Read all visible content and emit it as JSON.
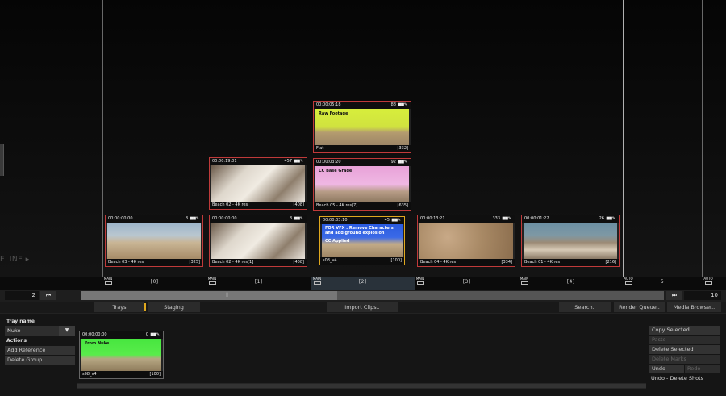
{
  "timeline": {
    "label": "ELINE ▸",
    "clips": [
      {
        "id": "c1",
        "timecode": "00:00:00:00",
        "count": "8",
        "name": "Beach 03 - 4K res",
        "num": "[325]",
        "thumb": "beach",
        "tag": ""
      },
      {
        "id": "c2",
        "timecode": "00:00:00:00",
        "count": "8",
        "name": "Beach 02 - 4K res[1]",
        "num": "[408]",
        "thumb": "wave",
        "tag": ""
      },
      {
        "id": "c3",
        "timecode": "00:00:19:01",
        "count": "457",
        "name": "Beach 02 - 4K res",
        "num": "[408]",
        "thumb": "wave",
        "tag": ""
      },
      {
        "id": "c4",
        "timecode": "00:00:05:18",
        "count": "88",
        "name": "Flat",
        "num": "[332]",
        "thumb": "green",
        "tag": "Raw Footage"
      },
      {
        "id": "c5",
        "timecode": "00:00:03:20",
        "count": "92",
        "name": "Beach 05 - 4K res[7]",
        "num": "[635]",
        "thumb": "pink",
        "tag": "CC Base Grade"
      },
      {
        "id": "c6",
        "timecode": "00:00:03:10",
        "count": "45",
        "name": "s08_v4",
        "num": "[100]",
        "thumb": "blue",
        "tag": "FOR VFX : Remove Characters and add ground explosion",
        "tag2": "CC Applied"
      },
      {
        "id": "c7",
        "timecode": "00:00:13:21",
        "count": "333",
        "name": "Beach 04 - 4K res",
        "num": "[334]",
        "thumb": "sand",
        "tag": ""
      },
      {
        "id": "c8",
        "timecode": "00:00:01:22",
        "count": "26",
        "name": "Beach 01 - 4K res",
        "num": "[216]",
        "thumb": "rocks",
        "tag": ""
      }
    ]
  },
  "ruler": {
    "labels": [
      "[0]",
      "[1]",
      "[2]",
      "[3]",
      "[4]",
      "5"
    ],
    "marker_main": "MAIN",
    "marker_auto": "AUTO"
  },
  "scrub": {
    "start_value": "2",
    "end_value": "10",
    "prev_label": "⏮",
    "next_label": "⏭",
    "thumb_glyph": "⦀",
    "position": 0.44
  },
  "toolbar": {
    "trays": "Trays",
    "staging": "Staging",
    "import": "Import Clips..",
    "search": "Search..",
    "render": "Render Queue..",
    "media": "Media Browser.."
  },
  "bottom": {
    "tray_name_label": "Tray name",
    "tray_value": "Nuke",
    "actions_label": "Actions",
    "add_reference": "Add Reference",
    "delete_group": "Delete Group",
    "tray_clip": {
      "timecode": "00:00:00:00",
      "count": "0",
      "name": "s08_v4",
      "num": "[100]",
      "tag": "From Nuke"
    },
    "right_actions": [
      "Copy Selected",
      "Paste",
      "Delete Selected",
      "Delete Marks"
    ],
    "undo": "Undo",
    "redo": "Redo",
    "status": "Undo - Delete Shots"
  }
}
